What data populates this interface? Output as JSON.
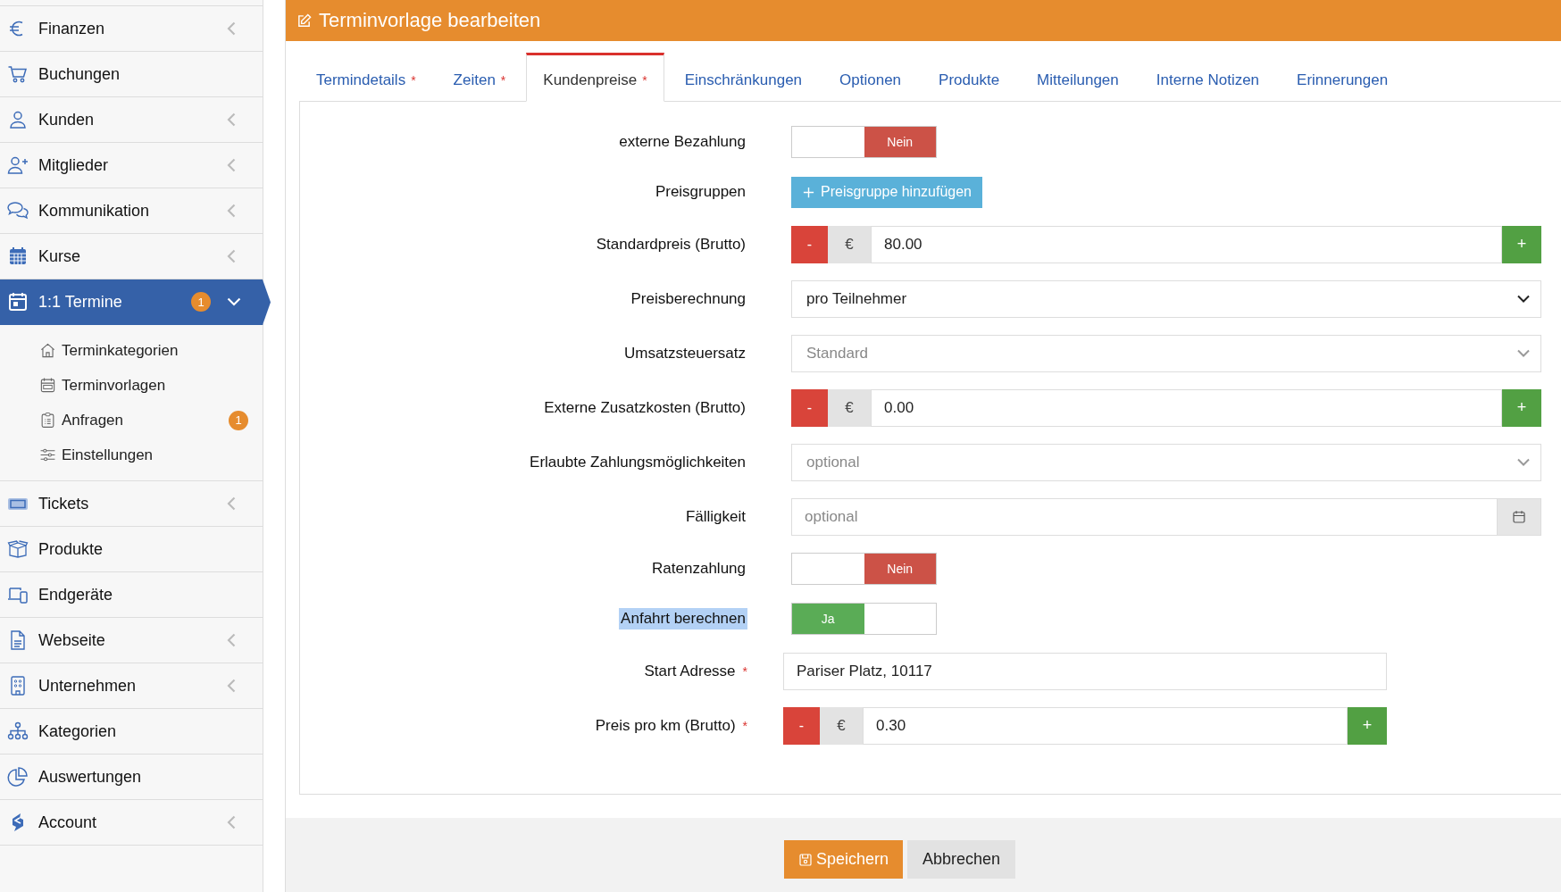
{
  "sidebar": {
    "items": [
      {
        "label": "Finanzen",
        "submenu": true,
        "expanded": false,
        "selected": false
      },
      {
        "label": "Buchungen",
        "submenu": false,
        "selected": false
      },
      {
        "label": "Kunden",
        "submenu": true,
        "expanded": false,
        "selected": false
      },
      {
        "label": "Mitglieder",
        "submenu": true,
        "expanded": false,
        "selected": false
      },
      {
        "label": "Kommunikation",
        "submenu": true,
        "expanded": false,
        "selected": false
      },
      {
        "label": "Kurse",
        "submenu": true,
        "expanded": false,
        "selected": false
      },
      {
        "label": "1:1 Termine",
        "submenu": true,
        "expanded": true,
        "selected": true,
        "badge": "1",
        "children": [
          {
            "label": "Terminkategorien"
          },
          {
            "label": "Terminvorlagen"
          },
          {
            "label": "Anfragen",
            "badge": "1"
          },
          {
            "label": "Einstellungen"
          }
        ]
      },
      {
        "label": "Tickets",
        "submenu": true,
        "expanded": false,
        "selected": false
      },
      {
        "label": "Produkte",
        "submenu": false,
        "selected": false
      },
      {
        "label": "Endgeräte",
        "submenu": false,
        "selected": false
      },
      {
        "label": "Webseite",
        "submenu": true,
        "expanded": false,
        "selected": false
      },
      {
        "label": "Unternehmen",
        "submenu": true,
        "expanded": false,
        "selected": false
      },
      {
        "label": "Kategorien",
        "submenu": false,
        "selected": false
      },
      {
        "label": "Auswertungen",
        "submenu": false,
        "selected": false
      },
      {
        "label": "Account",
        "submenu": true,
        "expanded": false,
        "selected": false
      }
    ]
  },
  "header": {
    "title": "Terminvorlage bearbeiten"
  },
  "tabs": [
    {
      "label": "Termindetails",
      "required_mark": "*",
      "selected": false
    },
    {
      "label": "Zeiten",
      "required_mark": "*",
      "selected": false
    },
    {
      "label": "Kundenpreise",
      "required_mark": "*",
      "selected": true
    },
    {
      "label": "Einschränkungen",
      "selected": false
    },
    {
      "label": "Optionen",
      "selected": false
    },
    {
      "label": "Produkte",
      "selected": false
    },
    {
      "label": "Mitteilungen",
      "selected": false
    },
    {
      "label": "Interne Notizen",
      "selected": false
    },
    {
      "label": "Erinnerungen",
      "selected": false
    }
  ],
  "form": {
    "rows": [
      {
        "label": "externe Bezahlung",
        "kind": "toggle",
        "on": false,
        "value_label": "Nein",
        "highlighted": false
      },
      {
        "label": "Preisgruppen",
        "kind": "button",
        "button": "Preisgruppe hinzufügen",
        "highlighted": false
      },
      {
        "label": "Standardpreis (Brutto)",
        "kind": "price",
        "minus": "-",
        "currency": "€",
        "value": "80.00",
        "plus": "+",
        "highlighted": false
      },
      {
        "label": "Preisberechnung",
        "kind": "select",
        "value": "pro Teilnehmer",
        "highlighted": false
      },
      {
        "label": "Umsatzsteuersatz",
        "kind": "select",
        "placeholder": "Standard",
        "highlighted": false
      },
      {
        "label": "Externe Zusatzkosten (Brutto)",
        "kind": "price",
        "minus": "-",
        "currency": "€",
        "value": "0.00",
        "plus": "+",
        "highlighted": false
      },
      {
        "label": "Erlaubte Zahlungsmöglichkeiten",
        "kind": "select",
        "placeholder": "optional",
        "highlighted": false
      },
      {
        "label": "Fälligkeit",
        "kind": "date",
        "placeholder": "optional",
        "highlighted": false
      },
      {
        "label": "Ratenzahlung",
        "kind": "toggle",
        "on": false,
        "value_label": "Nein",
        "highlighted": false
      },
      {
        "label": "Anfahrt berechnen",
        "kind": "toggle",
        "on": true,
        "value_label": "Ja",
        "highlighted": true
      },
      {
        "label": "Start Adresse",
        "required_mark": "*",
        "kind": "text",
        "value": "Pariser Platz, 10117",
        "highlighted": false
      },
      {
        "label": "Preis pro km (Brutto)",
        "required_mark": "*",
        "kind": "price",
        "minus": "-",
        "currency": "€",
        "value": "0.30",
        "plus": "+",
        "highlighted": false
      }
    ]
  },
  "footer": {
    "buttons": [
      {
        "label": "Speichern",
        "kind": "primary"
      },
      {
        "label": "Abbrechen",
        "kind": "secondary"
      }
    ]
  }
}
